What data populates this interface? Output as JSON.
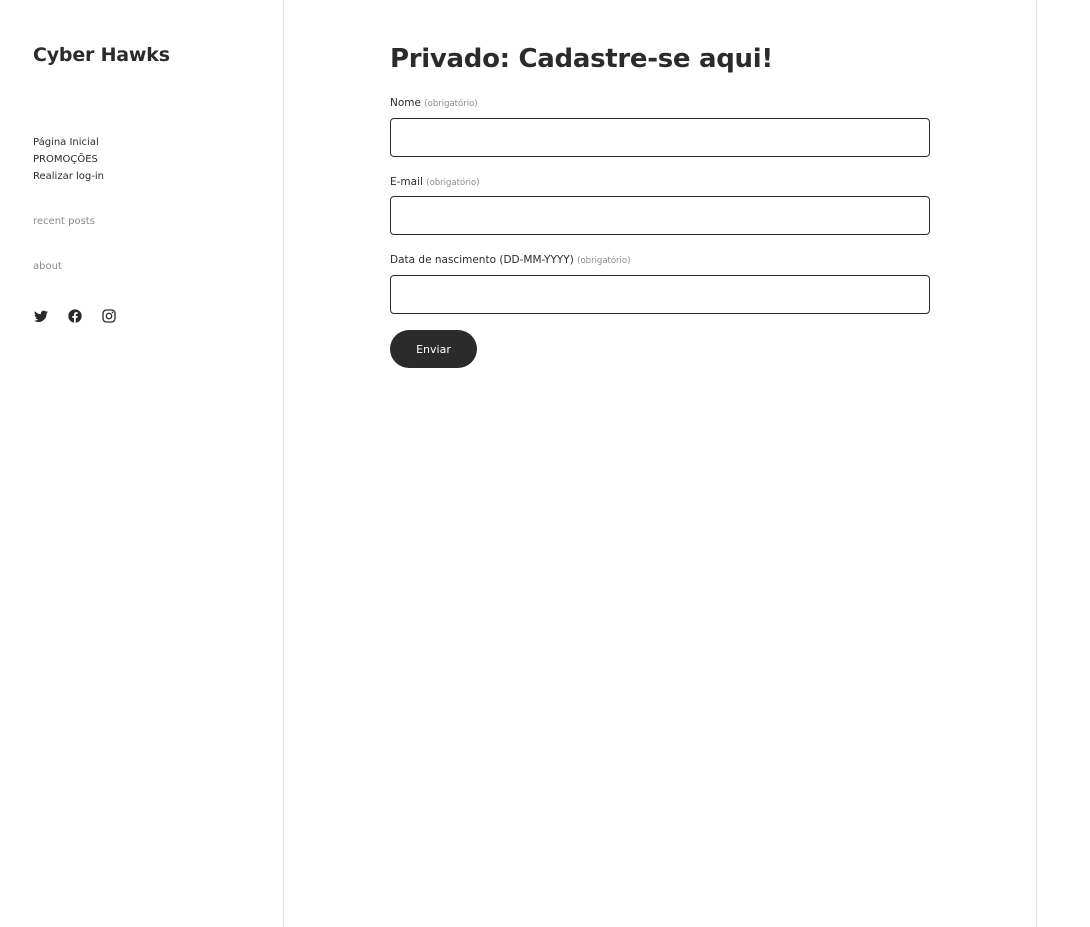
{
  "sidebar": {
    "site_title": "Cyber Hawks",
    "nav": [
      {
        "label": "Página Inicial"
      },
      {
        "label": "PROMOÇÕES"
      },
      {
        "label": "Realizar log-in"
      }
    ],
    "recent_posts": "recent posts",
    "about": "about",
    "social_icons": [
      "twitter-icon",
      "facebook-icon",
      "instagram-icon"
    ]
  },
  "main": {
    "title": "Privado: Cadastre-se aqui!",
    "fields": [
      {
        "label": "Nome",
        "required": "(obrigatório)",
        "value": ""
      },
      {
        "label": "E-mail",
        "required": "(obrigatório)",
        "value": ""
      },
      {
        "label": "Data de nascimento (DD-MM-YYYY)",
        "required": "(obrigatório)",
        "value": ""
      }
    ],
    "submit_label": "Enviar"
  },
  "colors": {
    "text": "#2b2b2b",
    "muted": "#8a8a8a",
    "border": "#e2e2e2",
    "button_bg": "#2b2b2b",
    "button_text": "#ffffff"
  }
}
